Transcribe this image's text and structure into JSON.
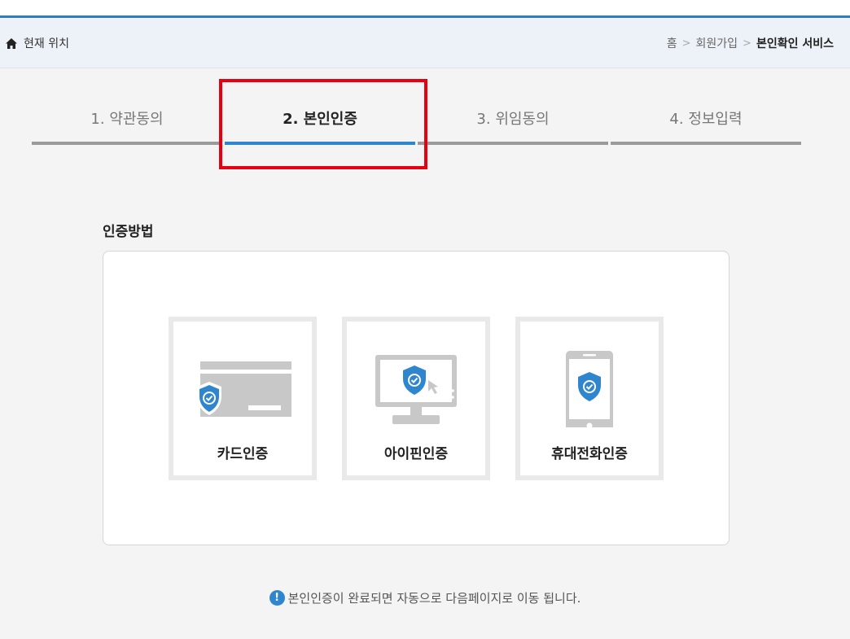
{
  "location": {
    "label": "현재 위치",
    "icon": "home-icon"
  },
  "breadcrumb": {
    "home": "홈",
    "sep": ">",
    "level1": "회원가입",
    "current": "본인확인 서비스"
  },
  "steps": [
    {
      "label": "1. 약관동의",
      "active": false
    },
    {
      "label": "2. 본인인증",
      "active": true
    },
    {
      "label": "3. 위임동의",
      "active": false
    },
    {
      "label": "4. 정보입력",
      "active": false
    }
  ],
  "section": {
    "title": "인증방법"
  },
  "methods": [
    {
      "label": "카드인증",
      "icon": "card-shield-icon"
    },
    {
      "label": "아이핀인증",
      "icon": "monitor-shield-icon"
    },
    {
      "label": "휴대전화인증",
      "icon": "phone-shield-icon"
    }
  ],
  "notice": {
    "icon": "!",
    "text": "본인인증이 완료되면 자동으로 다음페이지로 이동 됩니다."
  },
  "colors": {
    "accent": "#2f86cf",
    "highlight": "#e60012",
    "icon_gray": "#c8c8c8"
  }
}
